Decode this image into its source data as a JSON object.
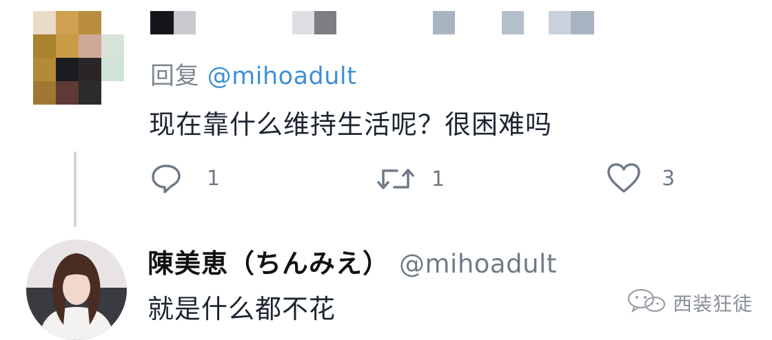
{
  "reply_prefix": "回复",
  "reply_to_handle": "@mihoadult",
  "tweet_text": "现在靠什么维持生活呢？很困难吗",
  "actions": {
    "reply_count": "1",
    "retweet_count": "1",
    "like_count": "3"
  },
  "reply_tweet": {
    "author_name": "陳美恵（ちんみえ）",
    "author_handle": "@mihoadult",
    "text": "就是什么都不花"
  },
  "watermark": "西装狂徒",
  "icons": {
    "reply": "speech-bubble-icon",
    "retweet": "retweet-arrows-icon",
    "like": "heart-icon",
    "watermark": "wechat-icon"
  },
  "colors": {
    "handle_blue": "#3d8fd6",
    "muted_gray": "#6e7a86",
    "text_dark": "#1c2530"
  }
}
